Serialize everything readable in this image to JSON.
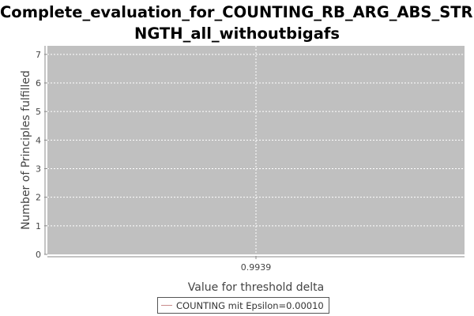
{
  "chart_data": {
    "type": "line",
    "title_line1": "Complete_evaluation_for_COUNTING_RB_ARG_ABS_STRE",
    "title_line2": "NGTH_all_withoutbigafs",
    "xlabel": "Value for threshold delta",
    "ylabel": "Number of Principles fulfilled",
    "categories": [
      "0.9939"
    ],
    "ylim": [
      0,
      7.3
    ],
    "yticks": [
      0,
      1,
      2,
      3,
      4,
      5,
      6,
      7
    ],
    "grid": true,
    "legend_position": "bottom",
    "series": [
      {
        "name": "COUNTING mit Epsilon=0.00010",
        "color": "#c98b8b",
        "values": []
      }
    ]
  }
}
